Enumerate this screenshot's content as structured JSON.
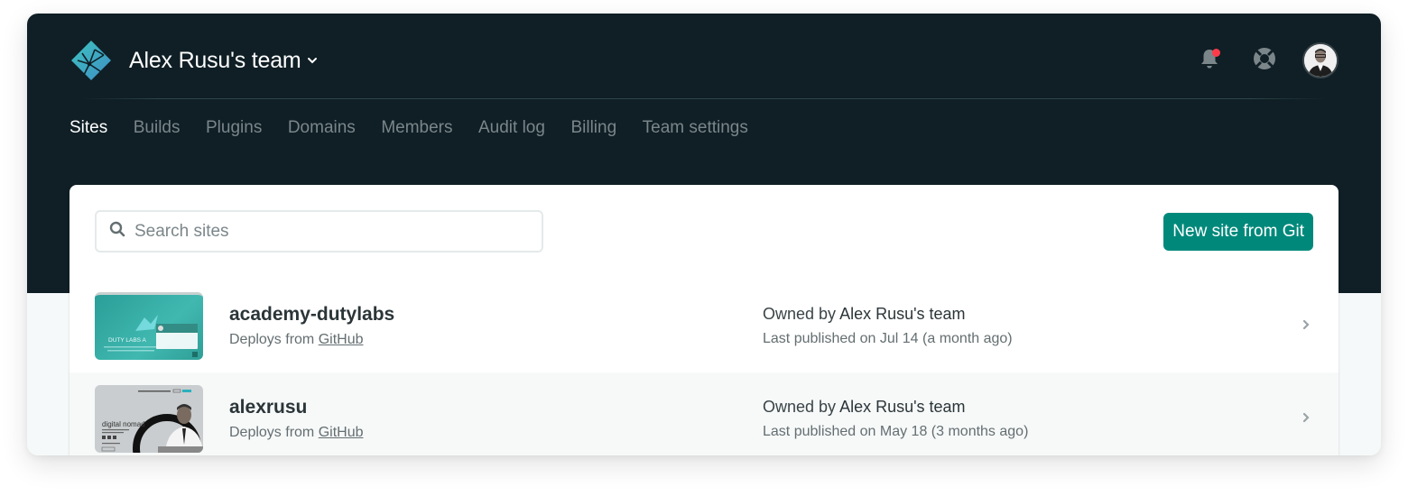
{
  "header": {
    "team_name": "Alex Rusu's team",
    "icons": {
      "logo": "netlify-logo-icon",
      "team_dropdown": "chevron-down-icon",
      "notifications": "bell-icon",
      "help": "lifebuoy-icon",
      "avatar": "user-avatar"
    },
    "notification_badge_color": "#ff3b4a"
  },
  "nav": {
    "items": [
      {
        "label": "Sites",
        "active": true
      },
      {
        "label": "Builds",
        "active": false
      },
      {
        "label": "Plugins",
        "active": false
      },
      {
        "label": "Domains",
        "active": false
      },
      {
        "label": "Members",
        "active": false
      },
      {
        "label": "Audit log",
        "active": false
      },
      {
        "label": "Billing",
        "active": false
      },
      {
        "label": "Team settings",
        "active": false
      }
    ]
  },
  "toolbar": {
    "search_placeholder": "Search sites",
    "search_value": "",
    "new_site_label": "New site from Git",
    "accent_color": "#00897b"
  },
  "sites": [
    {
      "name": "academy-dutylabs",
      "deploy_prefix": "Deploys from",
      "deploy_source": "GitHub",
      "owned_prefix": "Owned by",
      "owner": "Alex Rusu's team",
      "published": "Last published on Jul 14 (a month ago)",
      "thumbnail_text": "DUTY LABS A"
    },
    {
      "name": "alexrusu",
      "deploy_prefix": "Deploys from",
      "deploy_source": "GitHub",
      "owned_prefix": "Owned by",
      "owner": "Alex Rusu's team",
      "published": "Last published on May 18 (3 months ago)",
      "thumbnail_text": "digital nomad"
    }
  ]
}
